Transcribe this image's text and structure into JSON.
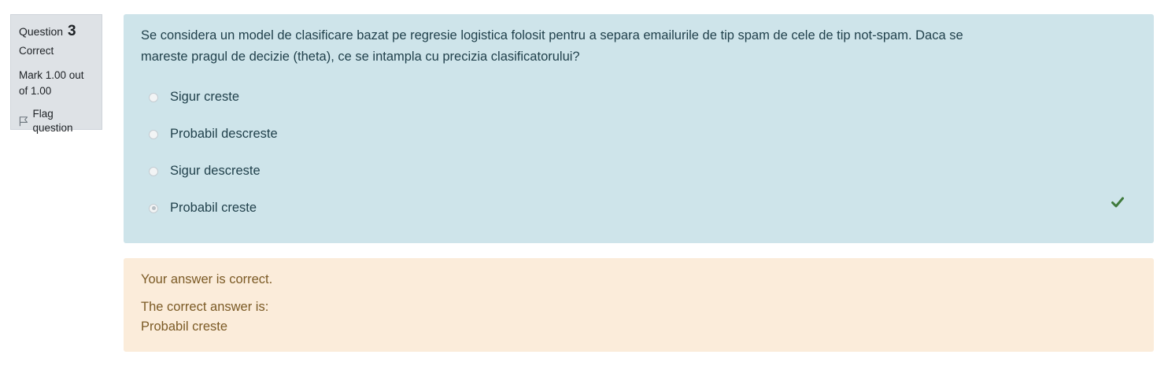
{
  "info": {
    "question_label": "Question",
    "question_number": "3",
    "state": "Correct",
    "grade": "Mark 1.00 out of 1.00",
    "flag_label": "Flag question"
  },
  "question": {
    "text": "Se considera un model de clasificare bazat pe regresie logistica folosit pentru a separa emailurile de tip spam de cele de tip not-spam. Daca se mareste pragul de decizie (theta), ce se intampla cu precizia clasificatorului?",
    "answers": [
      {
        "label": "Sigur creste",
        "selected": false
      },
      {
        "label": "Probabil descreste",
        "selected": false
      },
      {
        "label": "Sigur descreste",
        "selected": false
      },
      {
        "label": "Probabil creste",
        "selected": true
      }
    ],
    "correct_icon": "check-icon",
    "correct_icon_color": "#3f7a3c"
  },
  "outcome": {
    "feedback": "Your answer is correct.",
    "correct_answer_heading": "The correct answer is:",
    "correct_answer_value": "Probabil creste"
  },
  "colors": {
    "question_bg": "#cee4ea",
    "outcome_bg": "#fbecda",
    "info_bg": "#dee2e6"
  }
}
